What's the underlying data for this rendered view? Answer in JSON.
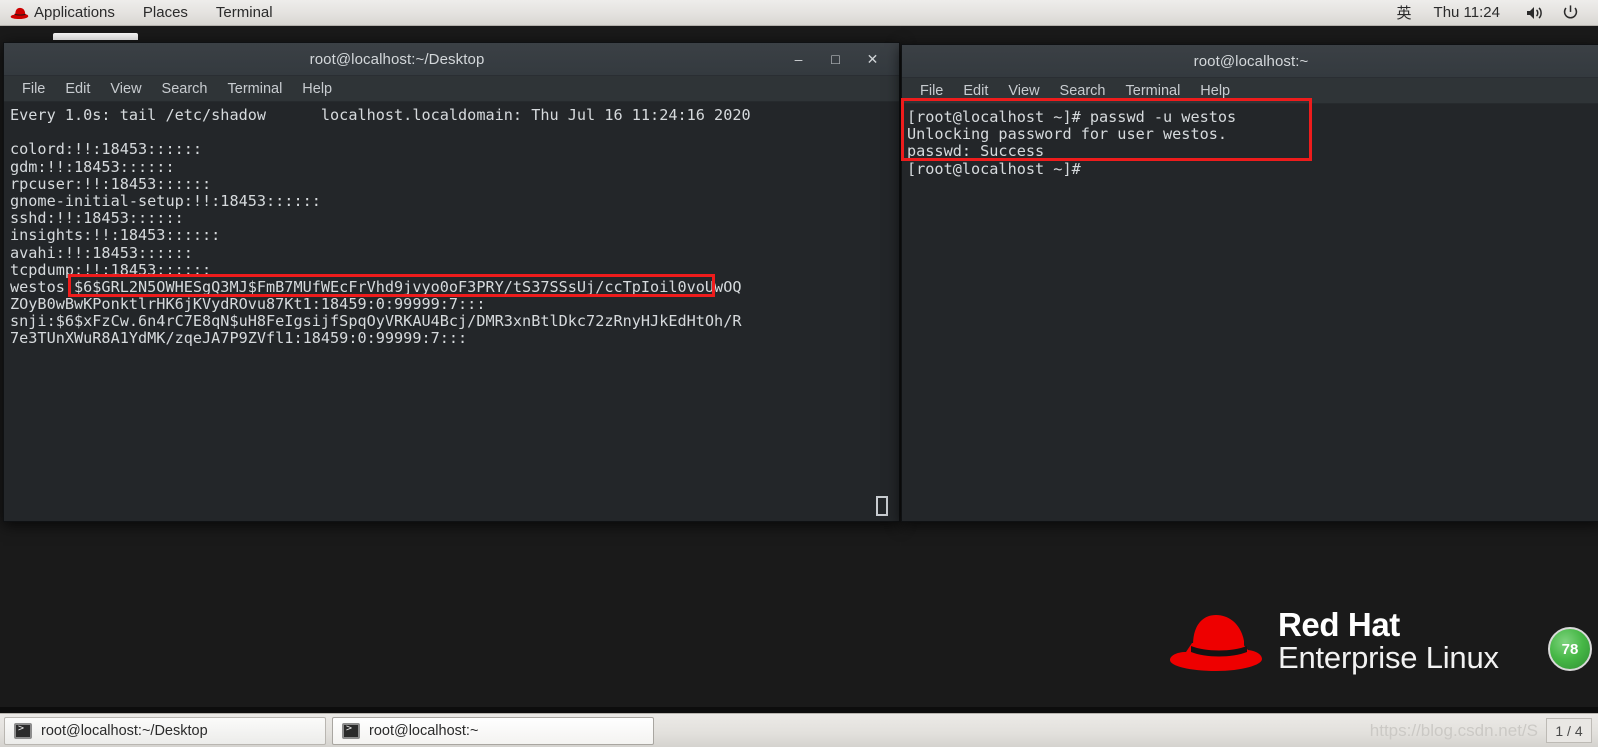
{
  "top_panel": {
    "logo_icon": "redhat-hat-icon",
    "menus": [
      "Applications",
      "Places",
      "Terminal"
    ],
    "ime_label": "英",
    "clock": "Thu 11:24",
    "volume_icon": "speaker-icon",
    "power_icon": "power-icon"
  },
  "window_left": {
    "title": "root@localhost:~/Desktop",
    "menus": [
      "File",
      "Edit",
      "View",
      "Search",
      "Terminal",
      "Help"
    ],
    "buttons": {
      "minimize": "–",
      "maximize": "□",
      "close": "✕"
    },
    "terminal_lines": [
      "Every 1.0s: tail /etc/shadow      localhost.localdomain: Thu Jul 16 11:24:16 2020",
      "",
      "colord:!!:18453::::::",
      "gdm:!!:18453::::::",
      "rpcuser:!!:18453::::::",
      "gnome-initial-setup:!!:18453::::::",
      "sshd:!!:18453::::::",
      "insights:!!:18453::::::",
      "avahi:!!:18453::::::",
      "tcpdump:!!:18453::::::",
      "westos:$6$GRL2N5OWHESgQ3MJ$FmB7MUfWEcFrVhd9jvyo0oF3PRY/tS37SSsUj/ccTpIoil0voUwOQ",
      "ZOyB0wBwKPonktlrHK6jKVydROvu87Kt1:18459:0:99999:7:::",
      "snji:$6$xFzCw.6n4rC7E8qN$uH8FeIgsijfSpqOyVRKAU4Bcj/DMR3xnBtlDkc72zRnyHJkEdHtOh/R",
      "7e3TUnXWuR8A1YdMK/zqeJA7P9ZVfl1:18459:0:99999:7:::"
    ]
  },
  "window_right": {
    "title": "root@localhost:~",
    "menus": [
      "File",
      "Edit",
      "View",
      "Search",
      "Terminal",
      "Help"
    ],
    "terminal_lines": [
      "[root@localhost ~]# passwd -u westos",
      "Unlocking password for user westos.",
      "passwd: Success",
      "[root@localhost ~]#"
    ]
  },
  "annotations": {
    "color": "#ee1c1c",
    "box_hash_label": "password-hash-highlight",
    "box_command_label": "passwd-unlock-highlight"
  },
  "desktop": {
    "brand_line1": "Red Hat",
    "brand_line2": "Enterprise Linux",
    "badge_value": "78"
  },
  "taskbar": {
    "tasks": [
      {
        "label": "root@localhost:~/Desktop",
        "active": false
      },
      {
        "label": "root@localhost:~",
        "active": true
      }
    ],
    "watermark": "https://blog.csdn.net/S",
    "workspace": "1 / 4"
  }
}
